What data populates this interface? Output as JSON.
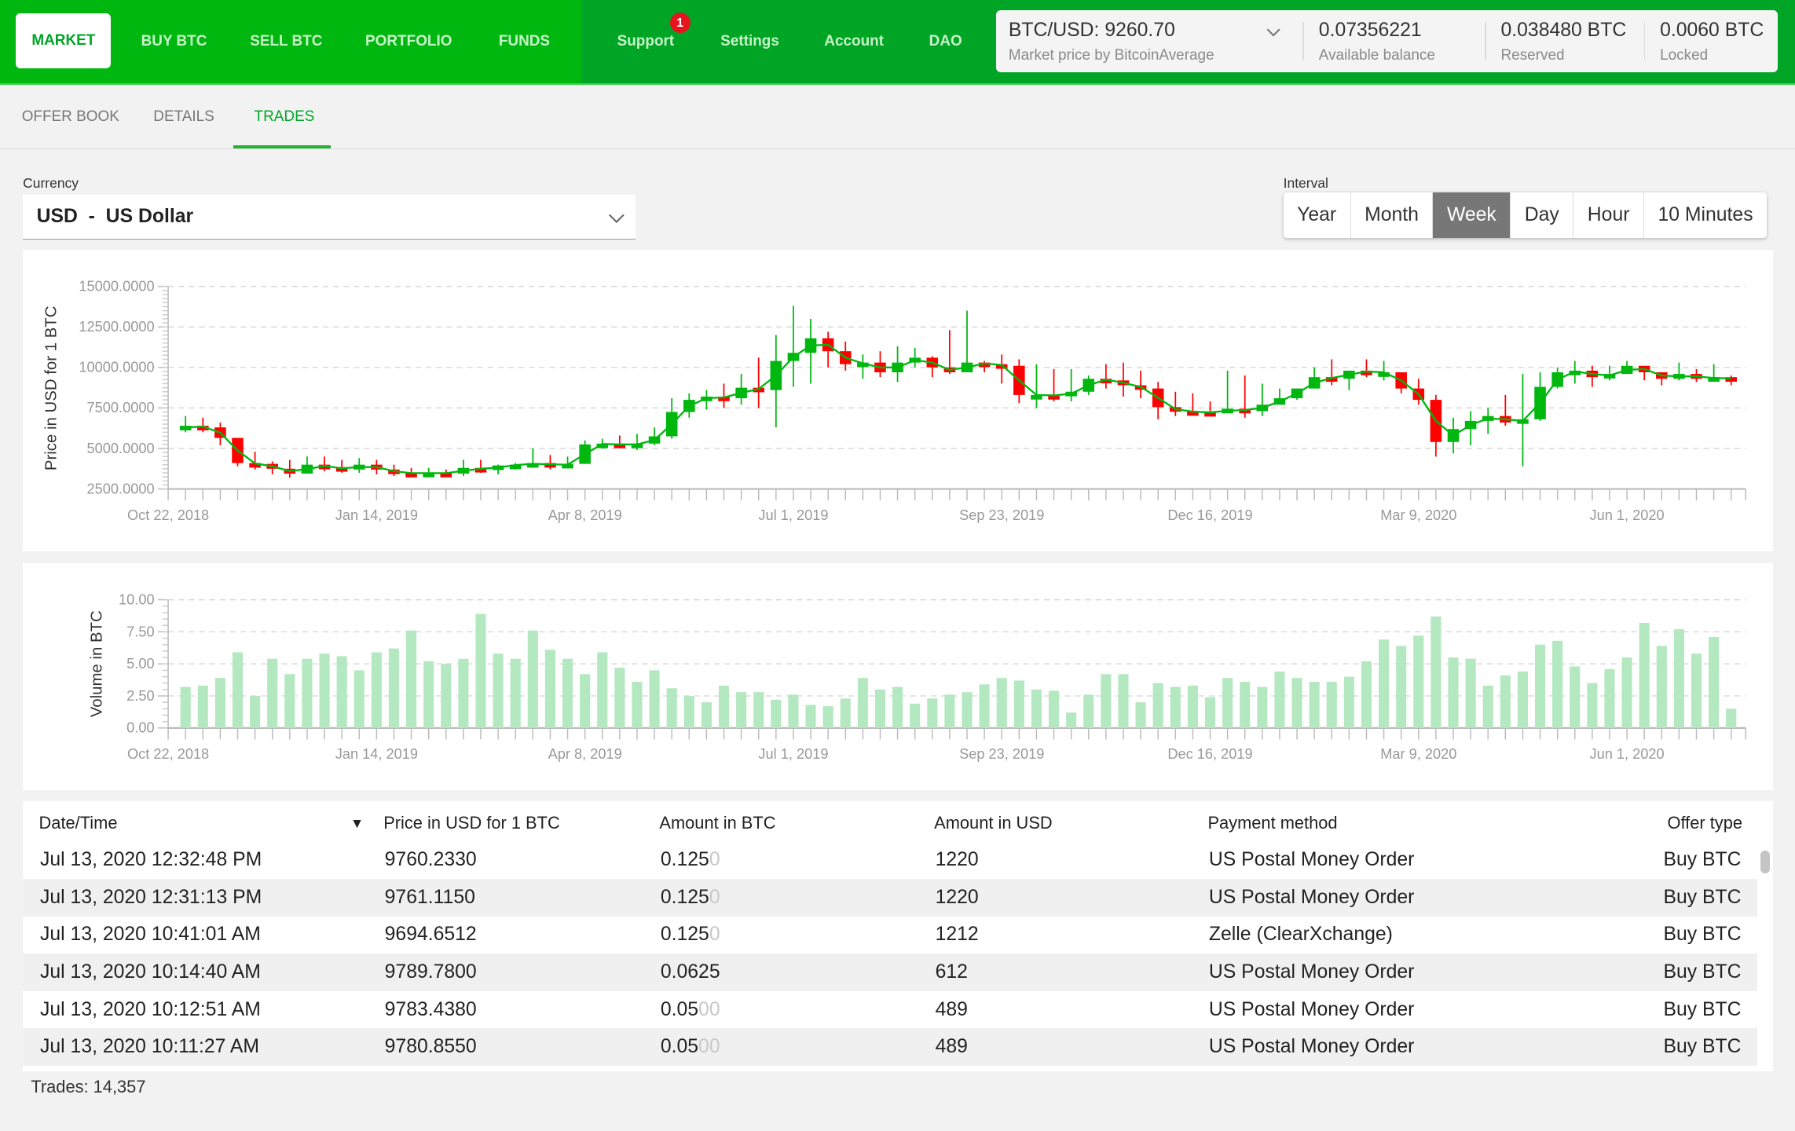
{
  "topbar": {
    "primary_nav": [
      "MARKET",
      "BUY BTC",
      "SELL BTC",
      "PORTFOLIO",
      "FUNDS"
    ],
    "secondary_nav": [
      "Support",
      "Settings",
      "Account",
      "DAO"
    ],
    "support_badge": "1",
    "market_price": {
      "value": "BTC/USD: 9260.70",
      "label": "Market price by BitcoinAverage"
    },
    "balances": [
      {
        "value": "0.07356221",
        "label": "Available balance"
      },
      {
        "value": "0.038480 BTC",
        "label": "Reserved"
      },
      {
        "value": "0.0060 BTC",
        "label": "Locked"
      }
    ]
  },
  "subtabs": [
    "OFFER BOOK",
    "DETAILS",
    "TRADES"
  ],
  "active_subtab": "TRADES",
  "currency": {
    "label": "Currency",
    "value": "USD  -  US Dollar"
  },
  "interval": {
    "label": "Interval",
    "options": [
      "Year",
      "Month",
      "Week",
      "Day",
      "Hour",
      "10 Minutes"
    ],
    "selected": "Week"
  },
  "colors": {
    "accent": "#00b70f",
    "up": "#00b70f",
    "down": "#ff0000",
    "volume": "#b4e8c0",
    "badge": "#e5141e"
  },
  "chart_data": [
    {
      "type": "candlestick",
      "ylabel": "Price in USD for 1 BTC",
      "ylim": [
        2500,
        15000
      ],
      "yticks": [
        "15000.0000",
        "12500.0000",
        "10000.0000",
        "7500.0000",
        "5000.0000",
        "2500.0000"
      ],
      "xticks": [
        "Oct 22, 2018",
        "Jan 14, 2019",
        "Apr 8, 2019",
        "Jul 1, 2019",
        "Sep 23, 2019",
        "Dec 16, 2019",
        "Mar 9, 2020",
        "Jun 1, 2020"
      ],
      "x_start": "Oct 22, 2018",
      "interval": "week",
      "grid": "horizontal dashed",
      "first_open": 6200,
      "close": [
        6400,
        6300,
        5650,
        4100,
        4050,
        3750,
        3450,
        4000,
        3850,
        3700,
        4000,
        3700,
        3500,
        3450,
        3500,
        3450,
        3800,
        3700,
        3950,
        4000,
        4100,
        3950,
        4050,
        5250,
        5300,
        5200,
        5300,
        5750,
        7250,
        8000,
        8200,
        8100,
        8750,
        8600,
        10400,
        10900,
        11800,
        11000,
        10200,
        10300,
        9700,
        10300,
        10600,
        10000,
        9700,
        10300,
        10200,
        10100,
        8300,
        8300,
        8250,
        8500,
        9300,
        9200,
        8900,
        8700,
        7550,
        7300,
        7250,
        7200,
        7450,
        7300,
        7700,
        8100,
        8700,
        9400,
        9300,
        9800,
        9700,
        9700,
        8700,
        8000,
        5400,
        6200,
        6700,
        7000,
        6600,
        6800,
        8800,
        9700,
        9800,
        9400,
        9600,
        10100,
        9700,
        9300,
        9600,
        9300,
        9400,
        9250
      ],
      "high": [
        7000,
        6900,
        6600,
        5300,
        4800,
        4200,
        4300,
        4500,
        4500,
        4300,
        4400,
        4300,
        4000,
        3800,
        3800,
        3700,
        4300,
        4300,
        4000,
        4100,
        5000,
        4600,
        4500,
        5500,
        5600,
        5800,
        5900,
        6300,
        8100,
        8400,
        8600,
        9000,
        9600,
        10600,
        12000,
        13800,
        13000,
        12200,
        11600,
        10800,
        11000,
        11300,
        11200,
        10700,
        12300,
        13500,
        10400,
        10800,
        10500,
        10200,
        9900,
        9900,
        9500,
        10200,
        10300,
        9800,
        9100,
        8500,
        8400,
        7900,
        9800,
        9500,
        9000,
        8700,
        8700,
        10000,
        10500,
        9700,
        10500,
        10400,
        9400,
        9300,
        8300,
        6900,
        7300,
        7500,
        8300,
        9600,
        9700,
        10000,
        10400,
        10100,
        10100,
        10400,
        10100,
        9600,
        10300,
        9900,
        10200,
        9500
      ],
      "low": [
        6000,
        6000,
        5200,
        3900,
        3700,
        3400,
        3200,
        3500,
        3600,
        3500,
        3500,
        3400,
        3300,
        3300,
        3300,
        3300,
        3300,
        3500,
        3400,
        3700,
        3800,
        3700,
        3800,
        4100,
        5000,
        5000,
        4900,
        5200,
        5600,
        6900,
        7400,
        7500,
        7700,
        7500,
        6300,
        8800,
        9000,
        10000,
        9800,
        9300,
        9400,
        9100,
        10000,
        9400,
        9600,
        9800,
        9700,
        9000,
        7800,
        7500,
        7900,
        7900,
        8300,
        8700,
        8200,
        8100,
        6800,
        7000,
        7100,
        7000,
        7200,
        6900,
        7000,
        7800,
        8000,
        8700,
        8900,
        8600,
        9400,
        9200,
        8400,
        7700,
        4500,
        4700,
        5200,
        5900,
        6400,
        3900,
        6700,
        8700,
        9000,
        8800,
        9200,
        9600,
        9200,
        8900,
        9200,
        9100,
        9200,
        8900
      ]
    },
    {
      "type": "bar",
      "ylabel": "Volume in BTC",
      "ylim": [
        0,
        10
      ],
      "yticks": [
        "10.00",
        "7.50",
        "5.00",
        "2.50",
        "0.00"
      ],
      "xticks": [
        "Oct 22, 2018",
        "Jan 14, 2019",
        "Apr 8, 2019",
        "Jul 1, 2019",
        "Sep 23, 2019",
        "Dec 16, 2019",
        "Mar 9, 2020",
        "Jun 1, 2020"
      ],
      "values": [
        3.2,
        3.3,
        3.9,
        5.9,
        2.5,
        5.4,
        4.2,
        5.4,
        5.8,
        5.6,
        4.5,
        5.9,
        6.2,
        7.6,
        5.2,
        5.0,
        5.4,
        8.9,
        5.8,
        5.4,
        7.6,
        6.1,
        5.4,
        4.2,
        5.9,
        4.7,
        3.6,
        4.5,
        3.1,
        2.5,
        2.0,
        3.3,
        2.8,
        2.8,
        2.2,
        2.6,
        1.8,
        1.7,
        2.3,
        3.9,
        3.0,
        3.2,
        1.9,
        2.3,
        2.6,
        2.8,
        3.4,
        3.9,
        3.7,
        3.0,
        2.9,
        1.2,
        2.6,
        4.2,
        4.2,
        2.0,
        3.5,
        3.2,
        3.3,
        2.4,
        3.9,
        3.6,
        3.2,
        4.4,
        3.9,
        3.6,
        3.6,
        4.0,
        5.2,
        6.9,
        6.4,
        7.2,
        8.7,
        5.5,
        5.4,
        3.3,
        4.1,
        4.4,
        6.5,
        6.8,
        4.8,
        3.5,
        4.6,
        5.5,
        8.2,
        6.4,
        7.7,
        5.8,
        7.1,
        1.5
      ]
    }
  ],
  "table": {
    "columns": [
      "Date/Time",
      "Price in USD for 1 BTC",
      "Amount in BTC",
      "Amount in USD",
      "Payment method",
      "Offer type"
    ],
    "sort_icon": "triangle-down",
    "rows": [
      {
        "date": "Jul 13, 2020 12:32:48 PM",
        "price": "9760.2330",
        "amount": "0.125",
        "amount_pad": "0",
        "usd": "1220",
        "method": "US Postal Money Order",
        "type": "Buy BTC"
      },
      {
        "date": "Jul 13, 2020 12:31:13 PM",
        "price": "9761.1150",
        "amount": "0.125",
        "amount_pad": "0",
        "usd": "1220",
        "method": "US Postal Money Order",
        "type": "Buy BTC"
      },
      {
        "date": "Jul 13, 2020 10:41:01 AM",
        "price": "9694.6512",
        "amount": "0.125",
        "amount_pad": "0",
        "usd": "1212",
        "method": "Zelle (ClearXchange)",
        "type": "Buy BTC"
      },
      {
        "date": "Jul 13, 2020 10:14:40 AM",
        "price": "9789.7800",
        "amount": "0.0625",
        "amount_pad": "",
        "usd": "612",
        "method": "US Postal Money Order",
        "type": "Buy BTC"
      },
      {
        "date": "Jul 13, 2020 10:12:51 AM",
        "price": "9783.4380",
        "amount": "0.05",
        "amount_pad": "00",
        "usd": "489",
        "method": "US Postal Money Order",
        "type": "Buy BTC"
      },
      {
        "date": "Jul 13, 2020 10:11:27 AM",
        "price": "9780.8550",
        "amount": "0.05",
        "amount_pad": "00",
        "usd": "489",
        "method": "US Postal Money Order",
        "type": "Buy BTC"
      }
    ]
  },
  "footer": {
    "trades_count": "Trades: 14,357"
  }
}
